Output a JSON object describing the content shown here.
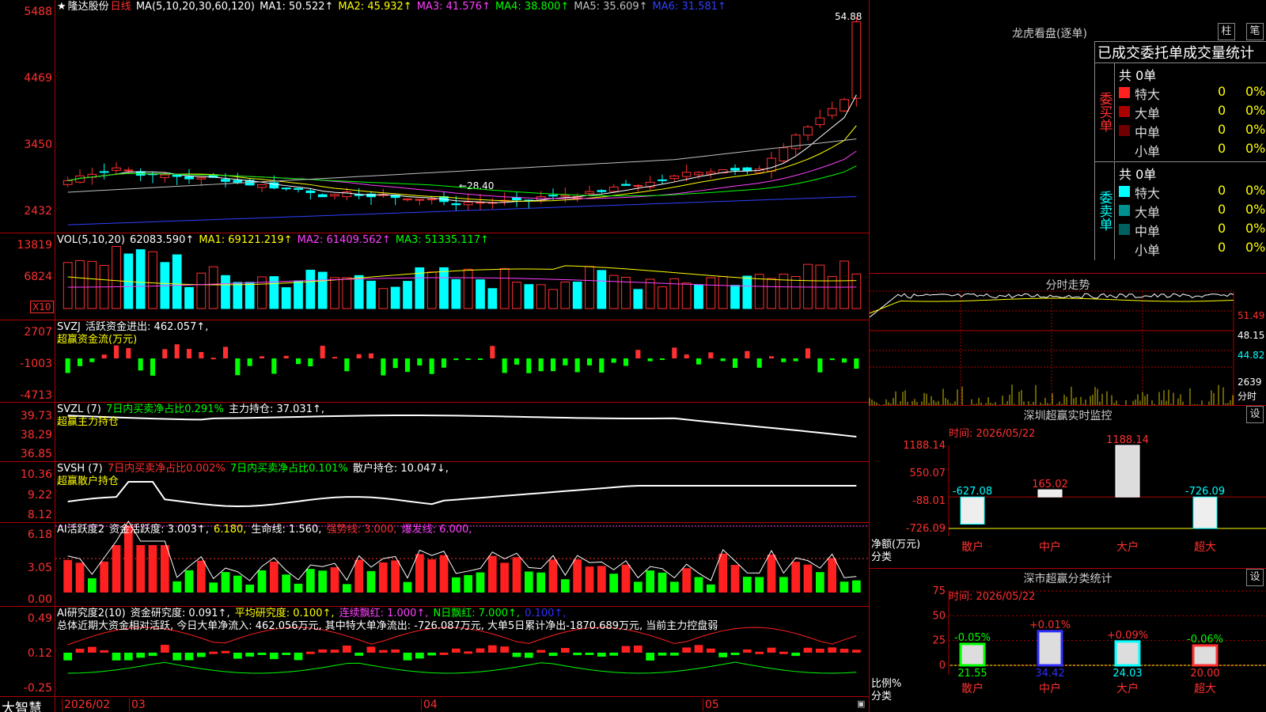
{
  "stock": {
    "star": "★",
    "name": "隆达股份",
    "period": "日线"
  },
  "main": {
    "ma_label": "MA(5,10,20,30,60,120)",
    "ma": [
      {
        "label": "MA1: 50.522↑",
        "color": "#ffffff"
      },
      {
        "label": "MA2: 45.932↑",
        "color": "#ffff00"
      },
      {
        "label": "MA3: 41.576↑",
        "color": "#ff40ff"
      },
      {
        "label": "MA4: 38.800↑",
        "color": "#00ff00"
      },
      {
        "label": "MA5: 35.609↑",
        "color": "#c0c0c0"
      },
      {
        "label": "MA6: 31.581↑",
        "color": "#3040ff"
      }
    ],
    "y_ticks": [
      "5488",
      "4469",
      "3450",
      "2432"
    ],
    "high_label": "54.88",
    "low_label": "28.40"
  },
  "vol": {
    "label": "VOL(5,10,20)",
    "value": "62083.590↑",
    "ma1": "MA1: 69121.219↑",
    "ma2": "MA2: 61409.562↑",
    "ma3": "MA3: 51335.117↑",
    "y_ticks": [
      "13819",
      "6824"
    ],
    "unit": "X10"
  },
  "svzj": {
    "label": "SVZJ",
    "desc": "活跃资金进出: 462.057↑,",
    "sub": "超赢资金流(万元)",
    "y_ticks": [
      "2707",
      "-1003",
      "-4713"
    ]
  },
  "svzl": {
    "label": "SVZL (7)",
    "p1": "7日内买卖净占比0.291%",
    "p2": "主力持仓: 37.031↑,",
    "sub": "超赢主力持仓",
    "y_ticks": [
      "39.73",
      "38.29",
      "36.85"
    ]
  },
  "svsh": {
    "label": "SVSH (7)",
    "p1": "7日内买卖净占比0.002%",
    "p2": "7日内买卖净占比0.101%",
    "p3": "散户持仓: 10.047↓,",
    "sub": "超赢散户持仓",
    "y_ticks": [
      "10.36",
      "9.22",
      "8.12"
    ]
  },
  "ai1": {
    "label": "AI活跃度2",
    "p1": "资金活跃度: 3.003↑,",
    "p2": "6.180,",
    "p3": "生命线: 1.560,",
    "p4": "强势线: 3.000,",
    "p5": "爆发线: 6.000,",
    "y_ticks": [
      "6.18",
      "3.05",
      "0.00"
    ]
  },
  "ai2": {
    "label": "AI研究度2(10)",
    "p1": "资金研究度: 0.091↑,",
    "p2": "平均研究度: 0.100↑,",
    "p3": "连续飘红: 1.000↑,",
    "p4": "N日飘红: 7.000↑,",
    "p5": "0.100↑,",
    "summary": "总体近期大资金相对活跃, 今日大单净流入: 462.056万元, 其中特大单净流出: -726.087万元, 大单5日累计净出-1870.689万元, 当前主力控盘弱",
    "y_ticks": [
      "0.49",
      "0.12",
      "-0.25"
    ]
  },
  "dates": [
    "2026/02",
    "03",
    "04",
    "05"
  ],
  "brand": "大智慧",
  "right": {
    "dragon": {
      "title": "龙虎看盘(逐单)",
      "btn1": "柱",
      "btn2": "笔",
      "header": "已成交委托单成交量统计",
      "buy": {
        "side": "委买单",
        "total": "共 0单",
        "rows": [
          {
            "name": "特大",
            "v": "0",
            "p": "0%",
            "c": "#ff2020"
          },
          {
            "name": "大单",
            "v": "0",
            "p": "0%",
            "c": "#aa0000"
          },
          {
            "name": "中单",
            "v": "0",
            "p": "0%",
            "c": "#700000"
          },
          {
            "name": "小单",
            "v": "0",
            "p": "0%",
            "c": "#000"
          }
        ]
      },
      "sell": {
        "side": "委卖单",
        "total": "共 0单",
        "rows": [
          {
            "name": "特大",
            "v": "0",
            "p": "0%",
            "c": "#00ffff"
          },
          {
            "name": "大单",
            "v": "0",
            "p": "0%",
            "c": "#009090"
          },
          {
            "name": "中单",
            "v": "0",
            "p": "0%",
            "c": "#006060"
          },
          {
            "name": "小单",
            "v": "0",
            "p": "0%",
            "c": "#000"
          }
        ]
      }
    },
    "intraday": {
      "title": "分时走势",
      "y_ticks": [
        "51.49",
        "48.15",
        "44.82"
      ],
      "vol_tick": "2639",
      "vol_unit": "分时"
    },
    "monitor": {
      "title": "深圳超赢实时监控",
      "btn": "设",
      "time": "时间: 2026/05/22",
      "y_ticks": [
        "1188.14",
        "550.07",
        "-88.01",
        "-726.09"
      ],
      "ylabel1": "净额(万元)",
      "ylabel2": "分类"
    },
    "classify": {
      "title": "深市超赢分类统计",
      "btn": "设",
      "time": "时间: 2026/05/22",
      "y_ticks": [
        "75",
        "50",
        "25",
        "0"
      ],
      "ylabel1": "比例%",
      "ylabel2": "分类"
    }
  },
  "chart_data": [
    {
      "type": "bar",
      "title": "深圳超赢实时监控",
      "categories": [
        "散户",
        "中户",
        "大户",
        "超大"
      ],
      "values": [
        -627.08,
        165.02,
        1188.14,
        -726.09
      ],
      "ylim": [
        -726.09,
        1188.14
      ],
      "ylabel": "净额(万元)",
      "xlabel": "分类"
    },
    {
      "type": "bar",
      "title": "深市超赢分类统计",
      "categories": [
        "散户",
        "中户",
        "大户",
        "超大"
      ],
      "values": [
        21.55,
        34.42,
        24.03,
        20.0
      ],
      "changes": [
        "-0.05%",
        "+0.01%",
        "+0.09%",
        "-0.06%"
      ],
      "ylim": [
        0,
        75
      ],
      "ylabel": "比例%",
      "xlabel": "分类"
    },
    {
      "type": "line",
      "title": "日线",
      "high": 54.88,
      "low": 28.4,
      "ylim": [
        24.32,
        54.88
      ]
    }
  ]
}
